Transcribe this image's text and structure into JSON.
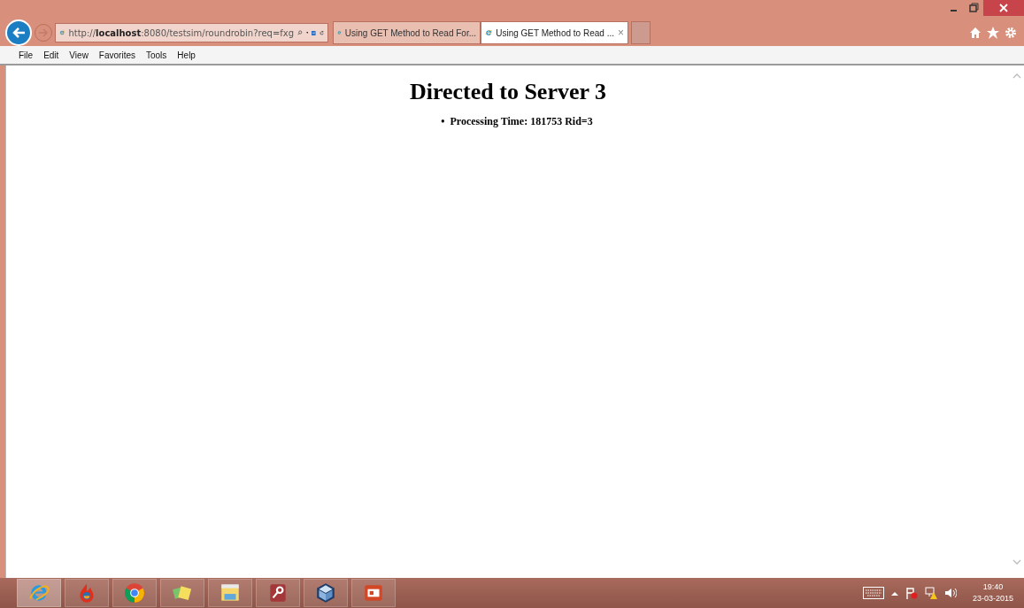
{
  "address_bar": {
    "url": "http://**localhost**:8080/testsim/roundrobin?req=fxg"
  },
  "tabs": [
    {
      "title": "Using GET Method to Read For...",
      "selected": false
    },
    {
      "title": "Using GET Method to Read ...",
      "selected": true,
      "close": "×"
    }
  ],
  "menu": [
    "File",
    "Edit",
    "View",
    "Favorites",
    "Tools",
    "Help"
  ],
  "page": {
    "heading": "Directed to Server 3",
    "items": [
      {
        "bullet": "•",
        "text": "Processing Time: 181753 Rid=3"
      }
    ]
  },
  "taskbar": {
    "apps": [
      {
        "kind": "ie",
        "active": true
      },
      {
        "kind": "firefox",
        "active": false
      },
      {
        "kind": "chrome",
        "active": false
      },
      {
        "kind": "notes",
        "active": false
      },
      {
        "kind": "explorer",
        "active": false
      },
      {
        "kind": "access",
        "active": false
      },
      {
        "kind": "box",
        "active": false
      },
      {
        "kind": "powerpoint",
        "active": false
      }
    ],
    "time": "19:40",
    "date": "23-03-2015"
  }
}
